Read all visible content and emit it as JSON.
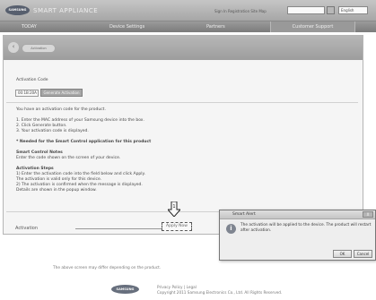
{
  "header": {
    "logo": "SAMSUNG",
    "title": "SMART APPLIANCE",
    "links": "Sign In   Registration   Site Map",
    "language": "English"
  },
  "nav": {
    "items": [
      "TODAY",
      "Device Settings",
      "Partners",
      "Customer Support"
    ],
    "active_index": 3
  },
  "panel": {
    "back_icon": "arrow-left-icon",
    "breadcrumb": "Activation",
    "lines": [
      {
        "text": "Activation Code",
        "bold": false
      },
      {
        "text": "You have an activation code for the product.",
        "bold": false
      },
      {
        "text": "1. Enter the MAC address of your Samsung device into the box.",
        "bold": false
      },
      {
        "text": "2. Click Generate button.",
        "bold": false
      },
      {
        "text": "3. Your activation code is displayed.",
        "bold": false
      },
      {
        "text": "* Needed for the Smart Control application for this product",
        "bold": true
      },
      {
        "text": "Smart Control Notes",
        "bold": true
      },
      {
        "text": "Enter the code shown on the screen of your device.",
        "bold": false
      },
      {
        "text": "Activation Steps",
        "bold": true
      },
      {
        "text": "1) Enter the activation code into the field below and click Apply.",
        "bold": false
      },
      {
        "text": "The activation is valid only for this device.",
        "bold": false
      },
      {
        "text": "2) The activation is confirmed when the message is displayed.",
        "bold": false
      },
      {
        "text": "Details are shown in the popup window.",
        "bold": false
      }
    ],
    "mac_value": "00:1B:20A",
    "generate_label": "Generate Activation Code",
    "validation_label": "Activation",
    "apply_label": "Apply Now"
  },
  "dialog": {
    "title": "Smart Alert",
    "close": "X",
    "icon": "info-icon",
    "message": "The activation will be applied to the device. The product will restart after activation.",
    "ok": "OK",
    "cancel": "Cancel"
  },
  "footer": {
    "note": "The above screen may differ depending on the product.",
    "logo": "SAMSUNG",
    "line1": "Privacy Policy | Legal",
    "line2": "Copyright 2011 Samsung Electronics Co., Ltd. All Rights Reserved."
  }
}
